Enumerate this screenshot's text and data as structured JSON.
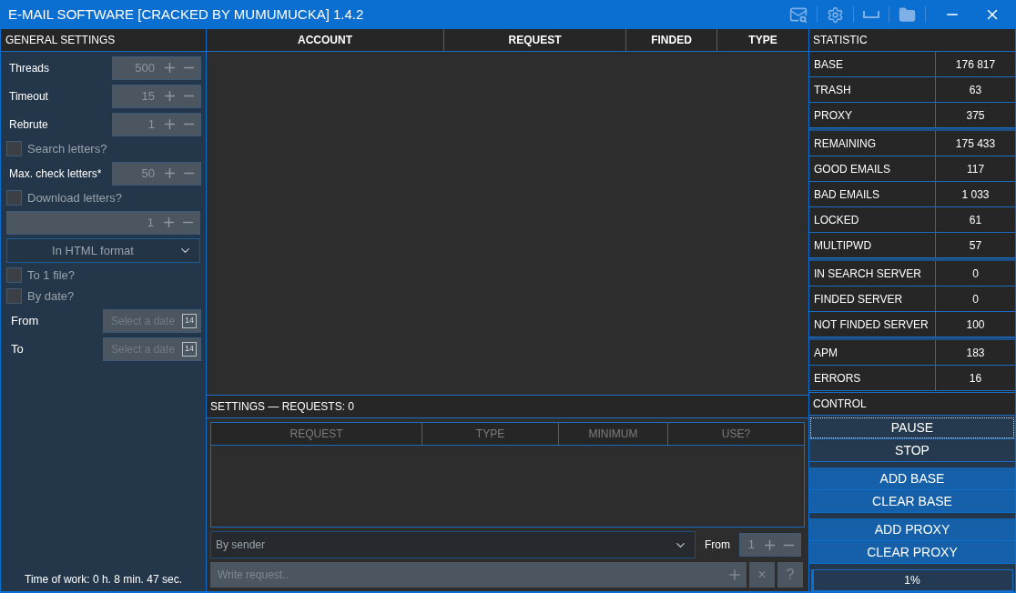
{
  "window": {
    "title": "E-MAIL SOFTWARE [CRACKED BY MUMUMUCKA] 1.4.2"
  },
  "general_settings": {
    "title": "GENERAL SETTINGS",
    "items": [
      {
        "kind": "spinner",
        "label": "Threads",
        "value": "500"
      },
      {
        "kind": "spinner",
        "label": "Timeout",
        "value": "15"
      },
      {
        "kind": "spinner",
        "label": "Rebrute",
        "value": "1"
      },
      {
        "kind": "checkbox",
        "label": "Search letters?",
        "checked": false
      },
      {
        "kind": "spinner",
        "label": "Max. check letters*",
        "value": "50"
      },
      {
        "kind": "checkbox",
        "label": "Download letters?",
        "checked": false
      },
      {
        "kind": "spinner",
        "value": "1"
      },
      {
        "kind": "select",
        "value": "In HTML format"
      },
      {
        "kind": "checkbox",
        "label": "To 1 file?",
        "checked": false
      },
      {
        "kind": "checkbox",
        "label": "By date?",
        "checked": false
      },
      {
        "kind": "date",
        "label": "From",
        "placeholder": "Select a date",
        "icon_text": "14"
      },
      {
        "kind": "date",
        "label": "To",
        "placeholder": "Select a date",
        "icon_text": "14"
      }
    ],
    "time_of_work": "Time of work: 0 h. 8 min. 47 sec."
  },
  "results_table": {
    "columns": [
      "ACCOUNT",
      "REQUEST",
      "FINDED",
      "TYPE"
    ]
  },
  "request_settings": {
    "title": "SETTINGS — REQUESTS: 0",
    "columns": [
      "REQUEST",
      "TYPE",
      "MINIMUM",
      "USE?"
    ],
    "filter": {
      "value": "By sender"
    },
    "from_label": "From",
    "from_value": "1",
    "request_input": {
      "placeholder": "Write request.."
    },
    "clear_button": "×",
    "help_button": "?"
  },
  "statistic": {
    "title": "STATISTIC",
    "groups": [
      [
        {
          "label": "BASE",
          "value": "176 817"
        },
        {
          "label": "TRASH",
          "value": "63"
        },
        {
          "label": "PROXY",
          "value": "375"
        }
      ],
      [
        {
          "label": "REMAINING",
          "value": "175 433"
        },
        {
          "label": "GOOD EMAILS",
          "value": "117"
        },
        {
          "label": "BAD EMAILS",
          "value": "1 033"
        },
        {
          "label": "LOCKED",
          "value": "61"
        },
        {
          "label": "MULTIPWD",
          "value": "57"
        }
      ],
      [
        {
          "label": "IN SEARCH SERVER",
          "value": "0"
        },
        {
          "label": "FINDED SERVER",
          "value": "0"
        },
        {
          "label": "NOT FINDED SERVER",
          "value": "100"
        }
      ],
      [
        {
          "label": "APM",
          "value": "183"
        },
        {
          "label": "ERRORS",
          "value": "16"
        }
      ]
    ]
  },
  "control": {
    "title": "CONTROL",
    "groups": [
      [
        {
          "label": "PAUSE",
          "kind": "dark",
          "focused": true
        },
        {
          "label": "STOP",
          "kind": "dark",
          "focused": false
        }
      ],
      [
        {
          "label": "ADD BASE",
          "kind": "blue",
          "focused": false
        },
        {
          "label": "CLEAR BASE",
          "kind": "blue",
          "focused": false
        }
      ],
      [
        {
          "label": "ADD PROXY",
          "kind": "blue",
          "focused": false
        },
        {
          "label": "CLEAR PROXY",
          "kind": "blue",
          "focused": false
        }
      ]
    ],
    "progress": {
      "level": 0.01,
      "reading": "1%"
    }
  }
}
